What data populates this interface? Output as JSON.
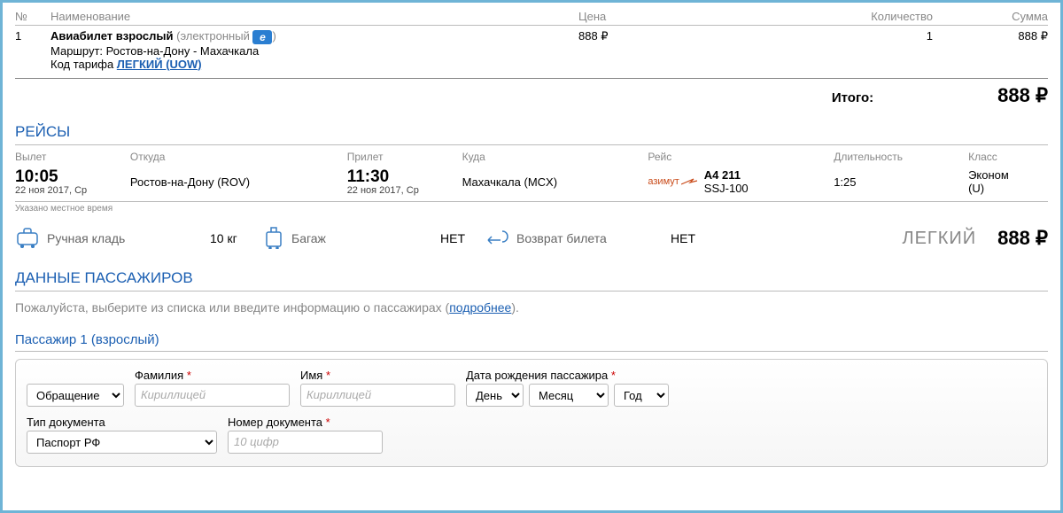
{
  "order_table": {
    "headers": {
      "num": "№",
      "name": "Наименование",
      "price": "Цена",
      "qty": "Количество",
      "sum": "Сумма"
    },
    "row": {
      "num": "1",
      "title": "Авиабилет взрослый",
      "electronic": "(электронный",
      "electronic_close": ")",
      "e_badge": "e",
      "route_label": "Маршрут:",
      "route": "Ростов-на-Дону - Махачкала",
      "tariff_label": "Код тарифа",
      "tariff_link": "ЛЕГКИЙ (UOW)",
      "price": "888 ₽",
      "qty": "1",
      "sum": "888 ₽"
    },
    "total_label": "Итого:",
    "total_value": "888 ₽"
  },
  "flights": {
    "title": "РЕЙСЫ",
    "headers": {
      "dep": "Вылет",
      "from": "Откуда",
      "arr": "Прилет",
      "to": "Куда",
      "flight": "Рейс",
      "dur": "Длительность",
      "class": "Класс"
    },
    "row": {
      "dep_time": "10:05",
      "dep_date": "22 ноя 2017, Ср",
      "from": "Ростов-на-Дону (ROV)",
      "arr_time": "11:30",
      "arr_date": "22 ноя 2017, Ср",
      "to": "Махачкала (MCX)",
      "airline": "азимут",
      "flight_no": "А4 211",
      "aircraft": "SSJ-100",
      "duration": "1:25",
      "class": "Эконом",
      "class_code": "(U)"
    },
    "local_time": "Указано местное время"
  },
  "fare": {
    "hand_label": "Ручная кладь",
    "hand_val": "10 кг",
    "bag_label": "Багаж",
    "bag_val": "НЕТ",
    "refund_label": "Возврат билета",
    "refund_val": "НЕТ",
    "tariff": "ЛЕГКИЙ",
    "price": "888 ₽"
  },
  "pax": {
    "title": "ДАННЫЕ ПАССАЖИРОВ",
    "instruction_prefix": "Пожалуйста, выберите из списка или введите информацию о пассажирах (",
    "instruction_link": "подробнее",
    "instruction_suffix": ").",
    "header": "Пассажир 1 (взрослый)",
    "form": {
      "salutation": "Обращение",
      "lastname_label": "Фамилия",
      "lastname_ph": "Кириллицей",
      "firstname_label": "Имя",
      "firstname_ph": "Кириллицей",
      "dob_label": "Дата рождения пассажира",
      "day": "День",
      "month": "Месяц",
      "year": "Год",
      "doctype_label": "Тип документа",
      "doctype": "Паспорт РФ",
      "docnum_label": "Номер документа",
      "docnum_ph": "10 цифр"
    }
  }
}
